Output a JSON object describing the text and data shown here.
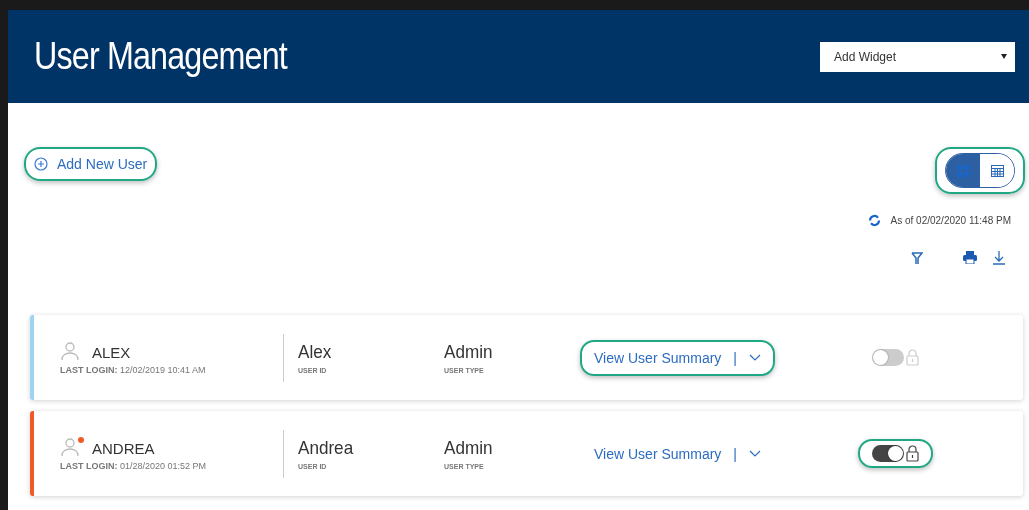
{
  "header": {
    "title": "User Management",
    "widget_select": {
      "value": "Add Widget"
    }
  },
  "add_user": {
    "label": "Add New User",
    "highlighted": true
  },
  "view_toggle": {
    "highlighted": true,
    "options": [
      {
        "kind": "grid",
        "selected": true
      },
      {
        "kind": "table",
        "selected": false
      }
    ]
  },
  "refresh": {
    "label": "As of 02/02/2020 11:48 PM"
  },
  "users": [
    {
      "name": "ALEX",
      "alert": false,
      "color": "#9fd3f2",
      "last_login_label": "LAST LOGIN:",
      "last_login": "12/02/2019 10:41 AM",
      "user_id": "Alex",
      "user_id_label": "USER ID",
      "user_type": "Admin",
      "user_type_label": "USER TYPE",
      "summary_link": "View User Summary",
      "separator": "|",
      "summary_highlighted": true,
      "lock_on": false,
      "lock_highlighted": false
    },
    {
      "name": "ANDREA",
      "alert": true,
      "color": "#f05a28",
      "last_login_label": "LAST LOGIN:",
      "last_login": "01/28/2020 01:52 PM",
      "user_id": "Andrea",
      "user_id_label": "USER ID",
      "user_type": "Admin",
      "user_type_label": "USER TYPE",
      "summary_link": "View User Summary",
      "separator": "|",
      "summary_highlighted": false,
      "lock_on": true,
      "lock_highlighted": true
    }
  ]
}
